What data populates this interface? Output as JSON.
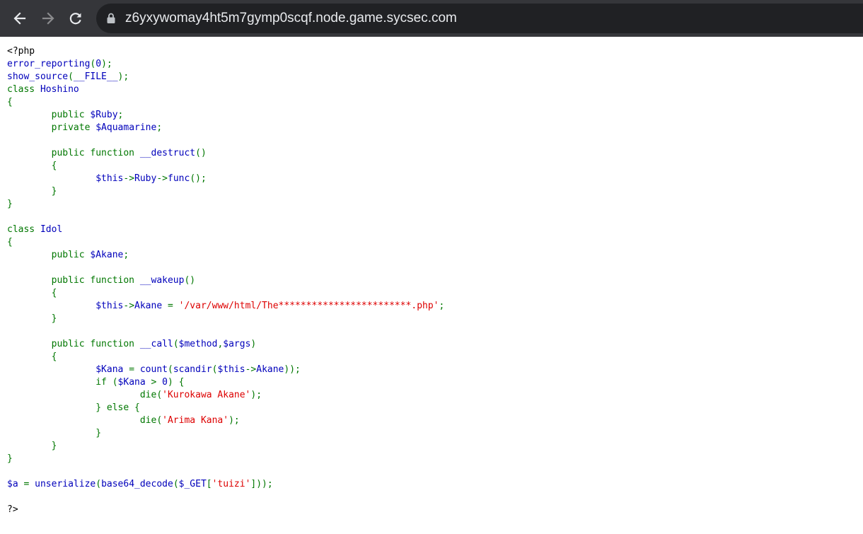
{
  "browser": {
    "url": "z6yxywomay4ht5m7gymp0scqf.node.game.sycsec.com",
    "icons": {
      "back": "arrow-left-icon",
      "forward": "arrow-right-icon",
      "reload": "reload-icon",
      "security": "lock-icon"
    }
  },
  "colors": {
    "toolbar": "#35363a",
    "omnibox": "#202124",
    "url_text": "#e8eaed",
    "php_default": "#0000bb",
    "php_keyword": "#007700",
    "php_string": "#dd0000",
    "php_html": "#000000"
  },
  "source_lines": [
    [
      {
        "t": "<?php",
        "c": "html"
      }
    ],
    [
      {
        "t": "error_reporting",
        "c": "default"
      },
      {
        "t": "(",
        "c": "keyword"
      },
      {
        "t": "0",
        "c": "default"
      },
      {
        "t": ");",
        "c": "keyword"
      }
    ],
    [
      {
        "t": "show_source",
        "c": "default"
      },
      {
        "t": "(",
        "c": "keyword"
      },
      {
        "t": "__FILE__",
        "c": "default"
      },
      {
        "t": ");",
        "c": "keyword"
      }
    ],
    [
      {
        "t": "class ",
        "c": "keyword"
      },
      {
        "t": "Hoshino",
        "c": "default"
      }
    ],
    [
      {
        "t": "{",
        "c": "keyword"
      }
    ],
    [
      {
        "t": "        public ",
        "c": "keyword"
      },
      {
        "t": "$Ruby",
        "c": "default"
      },
      {
        "t": ";",
        "c": "keyword"
      }
    ],
    [
      {
        "t": "        private ",
        "c": "keyword"
      },
      {
        "t": "$Aquamarine",
        "c": "default"
      },
      {
        "t": ";",
        "c": "keyword"
      }
    ],
    [],
    [
      {
        "t": "        public function ",
        "c": "keyword"
      },
      {
        "t": "__destruct",
        "c": "default"
      },
      {
        "t": "()",
        "c": "keyword"
      }
    ],
    [
      {
        "t": "        {",
        "c": "keyword"
      }
    ],
    [
      {
        "t": "                ",
        "c": "keyword"
      },
      {
        "t": "$this",
        "c": "default"
      },
      {
        "t": "->",
        "c": "keyword"
      },
      {
        "t": "Ruby",
        "c": "default"
      },
      {
        "t": "->",
        "c": "keyword"
      },
      {
        "t": "func",
        "c": "default"
      },
      {
        "t": "();",
        "c": "keyword"
      }
    ],
    [
      {
        "t": "        }",
        "c": "keyword"
      }
    ],
    [
      {
        "t": "}",
        "c": "keyword"
      }
    ],
    [],
    [
      {
        "t": "class ",
        "c": "keyword"
      },
      {
        "t": "Idol",
        "c": "default"
      }
    ],
    [
      {
        "t": "{",
        "c": "keyword"
      }
    ],
    [
      {
        "t": "        public ",
        "c": "keyword"
      },
      {
        "t": "$Akane",
        "c": "default"
      },
      {
        "t": ";",
        "c": "keyword"
      }
    ],
    [],
    [
      {
        "t": "        public function ",
        "c": "keyword"
      },
      {
        "t": "__wakeup",
        "c": "default"
      },
      {
        "t": "()",
        "c": "keyword"
      }
    ],
    [
      {
        "t": "        {",
        "c": "keyword"
      }
    ],
    [
      {
        "t": "                ",
        "c": "keyword"
      },
      {
        "t": "$this",
        "c": "default"
      },
      {
        "t": "->",
        "c": "keyword"
      },
      {
        "t": "Akane ",
        "c": "default"
      },
      {
        "t": "= ",
        "c": "keyword"
      },
      {
        "t": "'/var/www/html/The************************.php'",
        "c": "string"
      },
      {
        "t": ";",
        "c": "keyword"
      }
    ],
    [
      {
        "t": "        }",
        "c": "keyword"
      }
    ],
    [],
    [
      {
        "t": "        public function ",
        "c": "keyword"
      },
      {
        "t": "__call",
        "c": "default"
      },
      {
        "t": "(",
        "c": "keyword"
      },
      {
        "t": "$method",
        "c": "default"
      },
      {
        "t": ",",
        "c": "keyword"
      },
      {
        "t": "$args",
        "c": "default"
      },
      {
        "t": ")",
        "c": "keyword"
      }
    ],
    [
      {
        "t": "        {",
        "c": "keyword"
      }
    ],
    [
      {
        "t": "                ",
        "c": "keyword"
      },
      {
        "t": "$Kana ",
        "c": "default"
      },
      {
        "t": "= ",
        "c": "keyword"
      },
      {
        "t": "count",
        "c": "default"
      },
      {
        "t": "(",
        "c": "keyword"
      },
      {
        "t": "scandir",
        "c": "default"
      },
      {
        "t": "(",
        "c": "keyword"
      },
      {
        "t": "$this",
        "c": "default"
      },
      {
        "t": "->",
        "c": "keyword"
      },
      {
        "t": "Akane",
        "c": "default"
      },
      {
        "t": "));",
        "c": "keyword"
      }
    ],
    [
      {
        "t": "                if (",
        "c": "keyword"
      },
      {
        "t": "$Kana ",
        "c": "default"
      },
      {
        "t": "> ",
        "c": "keyword"
      },
      {
        "t": "0",
        "c": "default"
      },
      {
        "t": ") {",
        "c": "keyword"
      }
    ],
    [
      {
        "t": "                        die(",
        "c": "keyword"
      },
      {
        "t": "'Kurokawa Akane'",
        "c": "string"
      },
      {
        "t": ");",
        "c": "keyword"
      }
    ],
    [
      {
        "t": "                } else {",
        "c": "keyword"
      }
    ],
    [
      {
        "t": "                        die(",
        "c": "keyword"
      },
      {
        "t": "'Arima Kana'",
        "c": "string"
      },
      {
        "t": ");",
        "c": "keyword"
      }
    ],
    [
      {
        "t": "                }",
        "c": "keyword"
      }
    ],
    [
      {
        "t": "        }",
        "c": "keyword"
      }
    ],
    [
      {
        "t": "}",
        "c": "keyword"
      }
    ],
    [],
    [
      {
        "t": "$a ",
        "c": "default"
      },
      {
        "t": "= ",
        "c": "keyword"
      },
      {
        "t": "unserialize",
        "c": "default"
      },
      {
        "t": "(",
        "c": "keyword"
      },
      {
        "t": "base64_decode",
        "c": "default"
      },
      {
        "t": "(",
        "c": "keyword"
      },
      {
        "t": "$_GET",
        "c": "default"
      },
      {
        "t": "[",
        "c": "keyword"
      },
      {
        "t": "'tuizi'",
        "c": "string"
      },
      {
        "t": "]));",
        "c": "keyword"
      }
    ],
    [],
    [
      {
        "t": "?>",
        "c": "html"
      }
    ]
  ]
}
